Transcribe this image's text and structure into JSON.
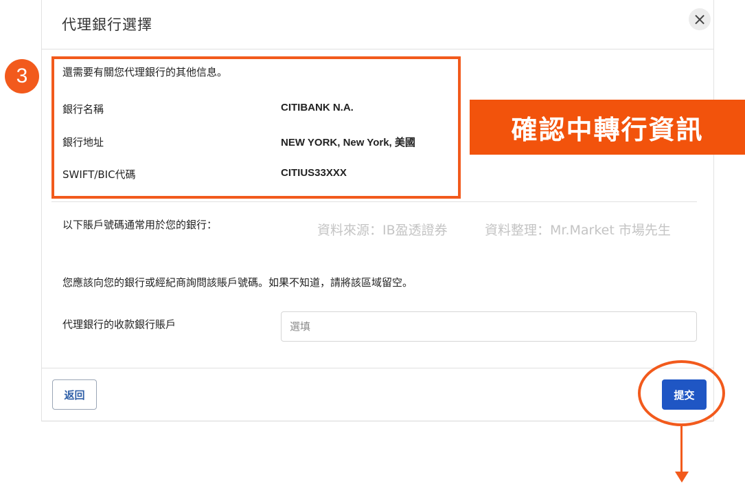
{
  "dialog": {
    "title": "代理銀行選擇",
    "close_icon": "×"
  },
  "annotations": {
    "step_number": "3",
    "banner_text": "確認中轉行資訊",
    "watermark_source": "資料來源：IB盈透證券",
    "watermark_author": "資料整理：Mr.Market 市場先生",
    "accent_color": "#f25a1c"
  },
  "bank_info": {
    "intro": "還需要有關您代理銀行的其他信息。",
    "rows": [
      {
        "label": "銀行名稱",
        "value": "CITIBANK N.A."
      },
      {
        "label": "銀行地址",
        "value": "NEW YORK, New York, 美國"
      },
      {
        "label": "SWIFT/BIC代碼",
        "value": "CITIUS33XXX"
      }
    ]
  },
  "account_section": {
    "common_text": "以下賬戶號碼通常用於您的銀行：",
    "advice_text": "您應該向您的銀行或經紀商詢問該賬戶號碼。如果不知道，請將該區域留空。",
    "field_label": "代理銀行的收款銀行賬戶",
    "field_value": "",
    "field_placeholder": "選填"
  },
  "footer": {
    "back_label": "返回",
    "submit_label": "提交",
    "submit_color": "#1f56c4"
  }
}
